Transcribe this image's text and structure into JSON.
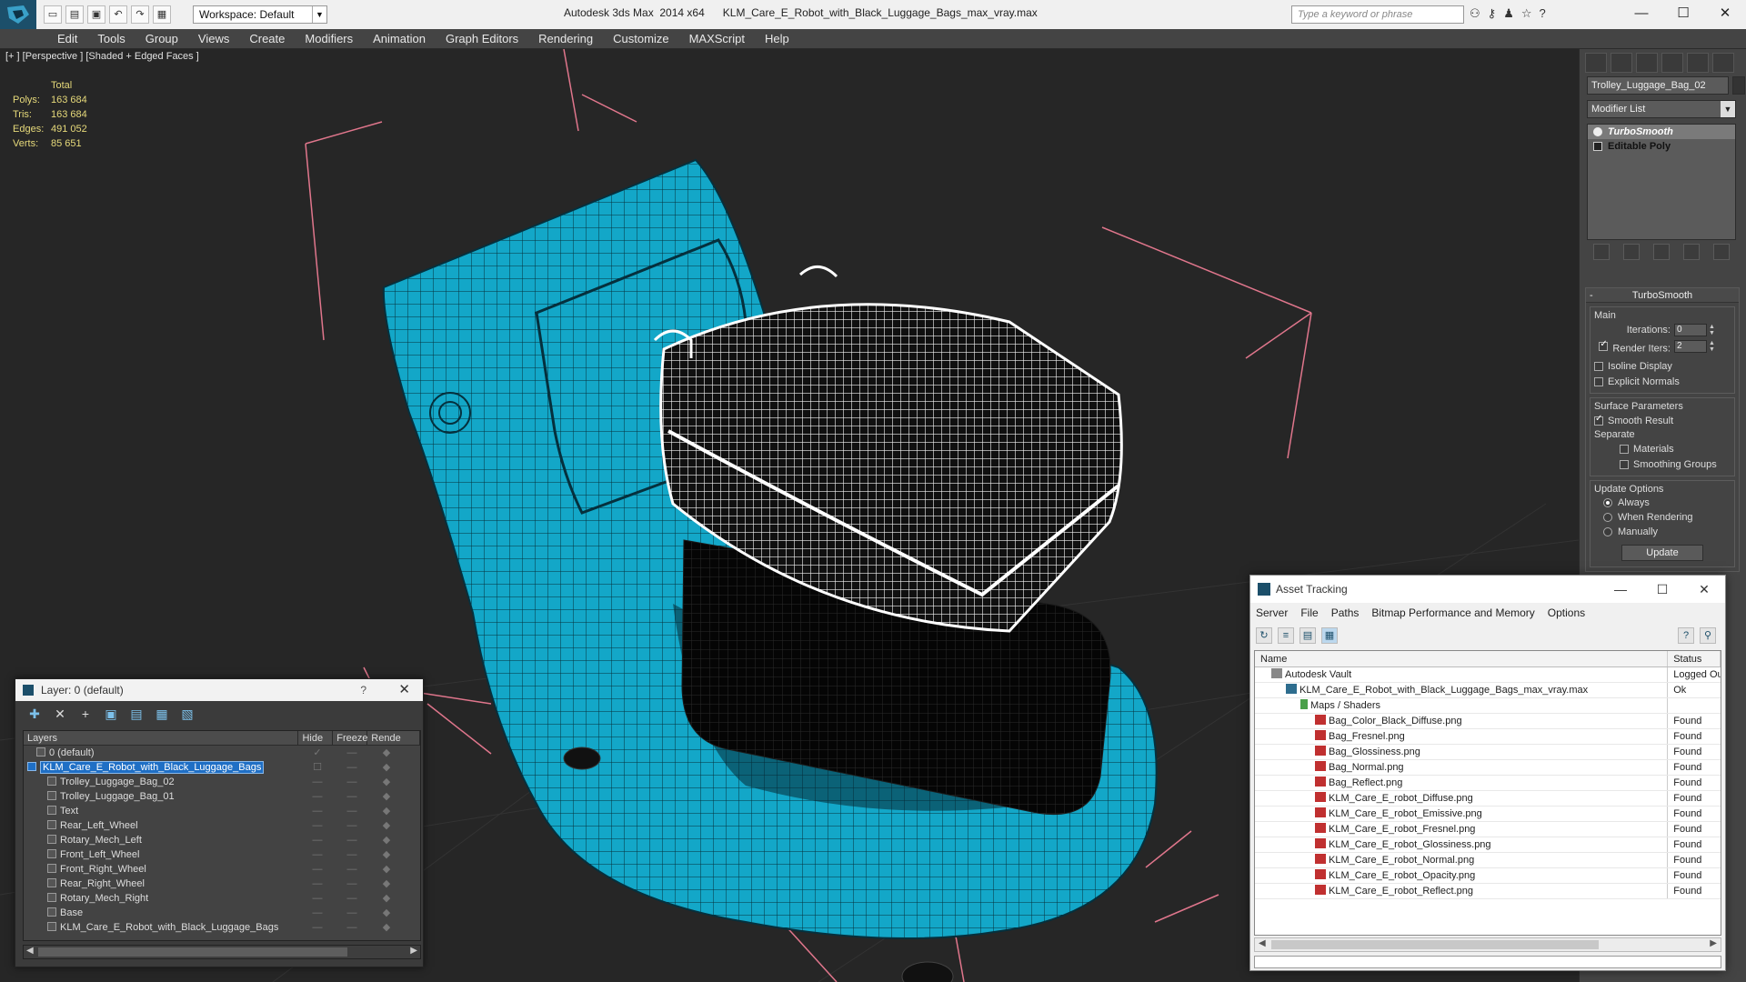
{
  "titlebar": {
    "workspace": "Workspace: Default",
    "title": "Autodesk 3ds Max  2014 x64      KLM_Care_E_Robot_with_Black_Luggage_Bags_max_vray.max",
    "search_placeholder": "Type a keyword or phrase"
  },
  "menu": [
    "Edit",
    "Tools",
    "Group",
    "Views",
    "Create",
    "Modifiers",
    "Animation",
    "Graph Editors",
    "Rendering",
    "Customize",
    "MAXScript",
    "Help"
  ],
  "viewport": {
    "label": "[+ ] [Perspective ] [Shaded + Edged Faces ]",
    "stats": {
      "header": "Total",
      "rows": [
        {
          "k": "Polys:",
          "v": "163 684"
        },
        {
          "k": "Tris:",
          "v": "163 684"
        },
        {
          "k": "Edges:",
          "v": "491 052"
        },
        {
          "k": "Verts:",
          "v": "85 651"
        }
      ]
    }
  },
  "command_panel": {
    "object_name": "Trolley_Luggage_Bag_02",
    "modifier_list": "Modifier List",
    "stack": [
      "TurboSmooth",
      "Editable Poly"
    ],
    "turbosmooth": {
      "title": "TurboSmooth",
      "main_label": "Main",
      "iterations_label": "Iterations:",
      "iterations": "0",
      "render_iters_label": "Render Iters:",
      "render_iters": "2",
      "isoline": "Isoline Display",
      "explicit": "Explicit Normals",
      "surface_label": "Surface Parameters",
      "smooth_result": "Smooth Result",
      "separate_label": "Separate",
      "materials": "Materials",
      "smoothing_groups": "Smoothing Groups",
      "update_options_label": "Update Options",
      "always": "Always",
      "when_rendering": "When Rendering",
      "manually": "Manually",
      "update_btn": "Update"
    }
  },
  "layer_dialog": {
    "title": "Layer: 0 (default)",
    "help": "?",
    "columns": [
      "Layers",
      "Hide",
      "Freeze",
      "Rende"
    ],
    "rows": [
      {
        "name": "0 (default)"
      },
      {
        "name": "KLM_Care_E_Robot_with_Black_Luggage_Bags"
      },
      {
        "name": "Trolley_Luggage_Bag_02"
      },
      {
        "name": "Trolley_Luggage_Bag_01"
      },
      {
        "name": "Text"
      },
      {
        "name": "Rear_Left_Wheel"
      },
      {
        "name": "Rotary_Mech_Left"
      },
      {
        "name": "Front_Left_Wheel"
      },
      {
        "name": "Front_Right_Wheel"
      },
      {
        "name": "Rear_Right_Wheel"
      },
      {
        "name": "Rotary_Mech_Right"
      },
      {
        "name": "Base"
      },
      {
        "name": "KLM_Care_E_Robot_with_Black_Luggage_Bags"
      }
    ]
  },
  "asset_tracking": {
    "title": "Asset Tracking",
    "menu": [
      "Server",
      "File",
      "Paths",
      "Bitmap Performance and Memory",
      "Options"
    ],
    "columns": [
      "Name",
      "Status"
    ],
    "rows": [
      {
        "name": "Autodesk Vault",
        "status": "Logged Ou",
        "kind": "vault"
      },
      {
        "name": "KLM_Care_E_Robot_with_Black_Luggage_Bags_max_vray.max",
        "status": "Ok",
        "kind": "max"
      },
      {
        "name": "Maps / Shaders",
        "status": "",
        "kind": "folder"
      },
      {
        "name": "Bag_Color_Black_Diffuse.png",
        "status": "Found",
        "kind": "png"
      },
      {
        "name": "Bag_Fresnel.png",
        "status": "Found",
        "kind": "png"
      },
      {
        "name": "Bag_Glossiness.png",
        "status": "Found",
        "kind": "png"
      },
      {
        "name": "Bag_Normal.png",
        "status": "Found",
        "kind": "png"
      },
      {
        "name": "Bag_Reflect.png",
        "status": "Found",
        "kind": "png"
      },
      {
        "name": "KLM_Care_E_robot_Diffuse.png",
        "status": "Found",
        "kind": "png"
      },
      {
        "name": "KLM_Care_E_robot_Emissive.png",
        "status": "Found",
        "kind": "png"
      },
      {
        "name": "KLM_Care_E_robot_Fresnel.png",
        "status": "Found",
        "kind": "png"
      },
      {
        "name": "KLM_Care_E_robot_Glossiness.png",
        "status": "Found",
        "kind": "png"
      },
      {
        "name": "KLM_Care_E_robot_Normal.png",
        "status": "Found",
        "kind": "png"
      },
      {
        "name": "KLM_Care_E_robot_Opacity.png",
        "status": "Found",
        "kind": "png"
      },
      {
        "name": "KLM_Care_E_robot_Reflect.png",
        "status": "Found",
        "kind": "png"
      }
    ]
  },
  "colors": {
    "robot_teal": "#13a7c8",
    "selection_bracket": "#e0768c",
    "stats_text": "#e6d97a"
  }
}
